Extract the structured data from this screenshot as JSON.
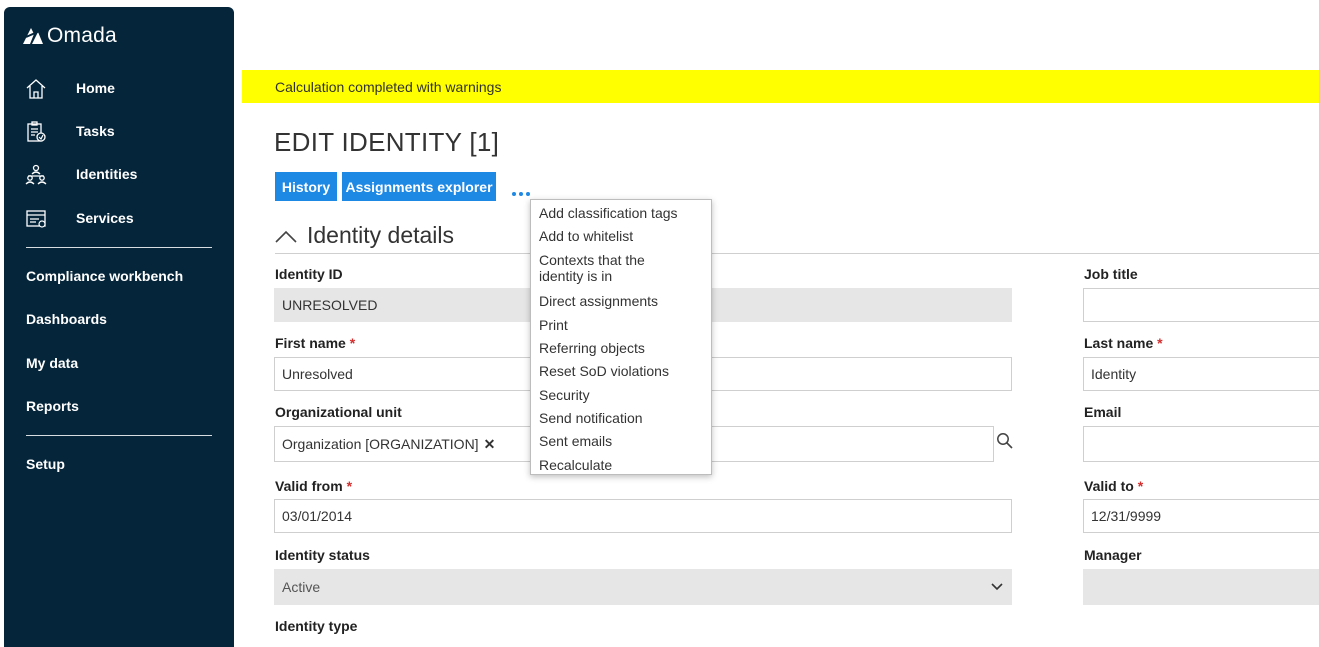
{
  "app": {
    "logo_text": "Omada"
  },
  "sidebar": {
    "items": [
      {
        "label": "Home",
        "icon": "home-icon"
      },
      {
        "label": "Tasks",
        "icon": "tasks-icon"
      },
      {
        "label": "Identities",
        "icon": "identities-icon"
      },
      {
        "label": "Services",
        "icon": "services-icon"
      }
    ],
    "links": [
      "Compliance workbench",
      "Dashboards",
      "My data",
      "Reports"
    ],
    "setup": "Setup"
  },
  "banner": {
    "text": "Calculation completed with warnings"
  },
  "page": {
    "title": "EDIT IDENTITY [1]",
    "buttons": {
      "history": "History",
      "assignments_explorer": "Assignments explorer"
    }
  },
  "section": {
    "title": "Identity details"
  },
  "form": {
    "identity_id": {
      "label": "Identity ID",
      "value": "UNRESOLVED"
    },
    "first_name": {
      "label": "First name",
      "value": "Unresolved"
    },
    "org_unit": {
      "label": "Organizational unit",
      "value": "Organization [ORGANIZATION]"
    },
    "valid_from": {
      "label": "Valid from",
      "value": "03/01/2014"
    },
    "identity_status": {
      "label": "Identity status",
      "value": "Active"
    },
    "identity_type": {
      "label": "Identity type"
    },
    "job_title": {
      "label": "Job title",
      "value": ""
    },
    "last_name": {
      "label": "Last name",
      "value": "Identity"
    },
    "email": {
      "label": "Email",
      "value": ""
    },
    "valid_to": {
      "label": "Valid to",
      "value": "12/31/9999"
    },
    "manager": {
      "label": "Manager",
      "value": ""
    },
    "required_mark": "*"
  },
  "menu": {
    "items": [
      "Add classification tags",
      "Add to whitelist",
      "Contexts that the identity is in",
      "Direct assignments",
      "Print",
      "Referring objects",
      "Reset SoD violations",
      "Security",
      "Send notification",
      "Sent emails",
      "Recalculate"
    ]
  },
  "colors": {
    "sidebar_bg": "#05253a",
    "banner_bg": "#ffff00",
    "button_bg": "#1e88e5",
    "required": "#d32f2f"
  }
}
